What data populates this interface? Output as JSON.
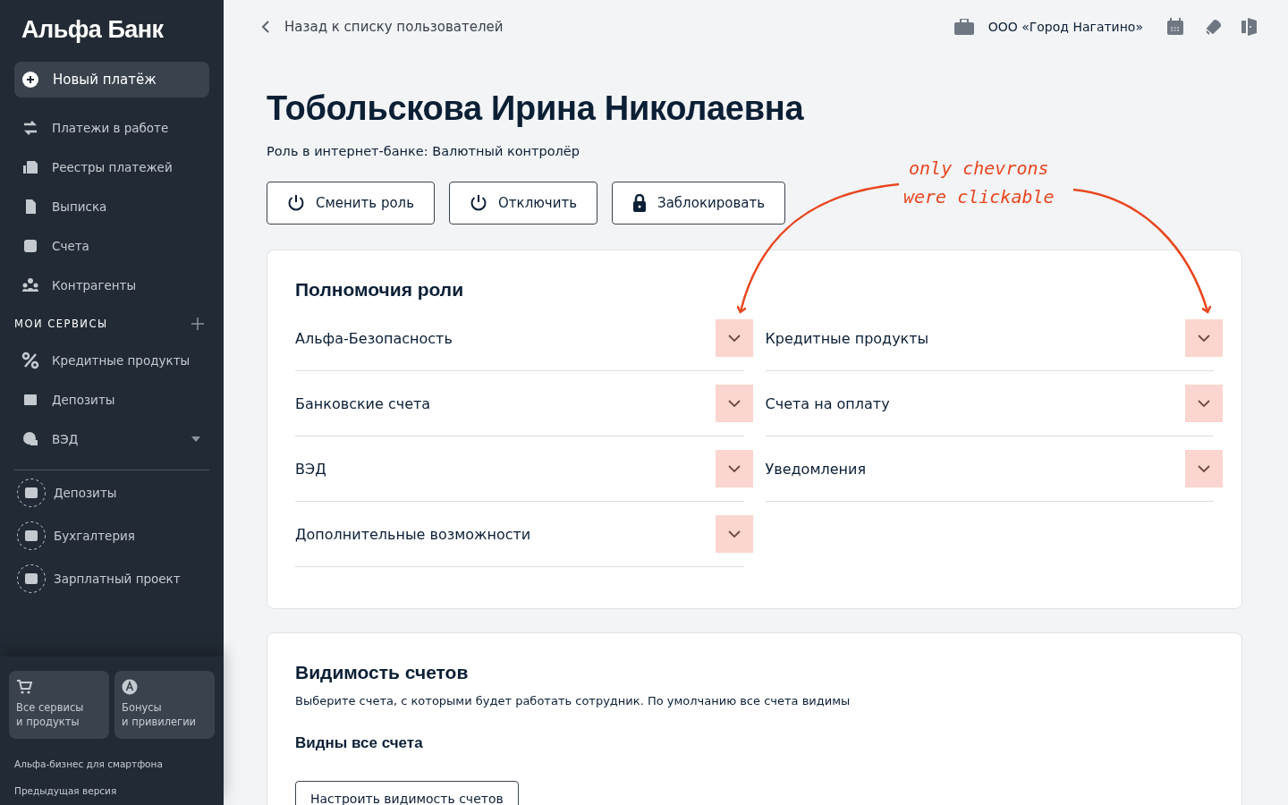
{
  "sidebar": {
    "logo": "Альфа Банк",
    "new_payment": "Новый платёж",
    "items": [
      {
        "label": "Платежи в работе"
      },
      {
        "label": "Реестры платежей"
      },
      {
        "label": "Выписка"
      },
      {
        "label": "Счета"
      },
      {
        "label": "Контрагенты"
      }
    ],
    "services_heading": "МОИ СЕРВИСЫ",
    "services": [
      {
        "label": "Кредитные продукты",
        "expandable": false
      },
      {
        "label": "Депозиты",
        "expandable": false
      },
      {
        "label": "ВЭД",
        "expandable": true
      }
    ],
    "suggested": [
      {
        "label": "Депозиты"
      },
      {
        "label": "Бухгалтерия"
      },
      {
        "label": "Зарплатный проект"
      }
    ],
    "tiles": [
      {
        "label": "Все сервисы\nи продукты"
      },
      {
        "label": "Бонусы\nи привилегии"
      }
    ],
    "links": [
      "Альфа-бизнес для смартфона",
      "Предыдущая версия"
    ]
  },
  "topbar": {
    "back": "Назад к списку пользователей",
    "company": "ООО «Город Нагатино»"
  },
  "user": {
    "name": "Тобольскова Ирина Николаевна",
    "role": "Роль в интернет-банке: Валютный контролёр",
    "actions": [
      {
        "label": "Сменить роль",
        "kind": "power"
      },
      {
        "label": "Отключить",
        "kind": "power"
      },
      {
        "label": "Заблокировать",
        "kind": "lock"
      }
    ]
  },
  "permissions": {
    "title": "Полномочия роли",
    "columns": [
      [
        "Альфа-Безопасность",
        "Банковские счета",
        "ВЭД",
        "Дополнительные возможности"
      ],
      [
        "Кредитные продукты",
        "Счета на оплату",
        "Уведомления"
      ]
    ]
  },
  "visibility": {
    "title": "Видимость счетов",
    "description": "Выберите счета, с которыми будет работать сотрудник. По умолчанию все счета видимы",
    "status": "Видны все счета",
    "button": "Настроить видимость счетов"
  },
  "annotation": {
    "lines": [
      "only chevrons",
      "were clickable"
    ]
  }
}
